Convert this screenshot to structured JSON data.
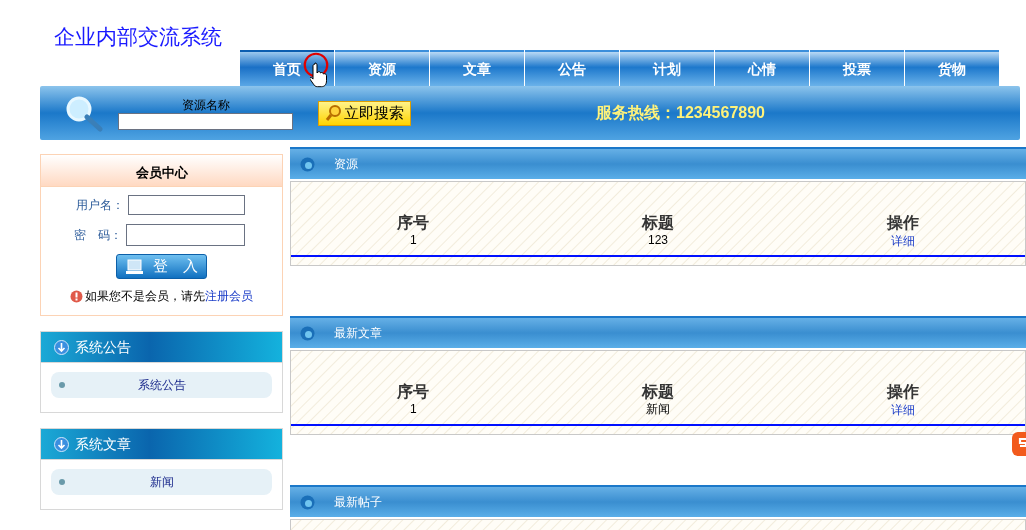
{
  "site_title": "企业内部交流系统",
  "nav_tabs": [
    {
      "label": "首页",
      "selected": true
    },
    {
      "label": "资源",
      "selected": false
    },
    {
      "label": "文章",
      "selected": false
    },
    {
      "label": "公告",
      "selected": false
    },
    {
      "label": "计划",
      "selected": false
    },
    {
      "label": "心情",
      "selected": false
    },
    {
      "label": "投票",
      "selected": false
    },
    {
      "label": "货物",
      "selected": false
    }
  ],
  "search": {
    "label": "资源名称",
    "button": "立即搜索",
    "hotline": "服务热线：1234567890"
  },
  "member_center": {
    "title": "会员中心",
    "username_label": "用户名：",
    "password_label": "密　码：",
    "login_button": "登　入",
    "notice": "如果您不是会员，请先",
    "register_link": "注册会员"
  },
  "side_panels": [
    {
      "title": "系统公告",
      "items": [
        "系统公告"
      ]
    },
    {
      "title": "系统文章",
      "items": [
        "新闻"
      ]
    }
  ],
  "sections": [
    {
      "title": "资源",
      "columns": [
        "序号",
        "标题",
        "操作"
      ],
      "rows": [
        [
          "1",
          "123",
          "详细"
        ]
      ]
    },
    {
      "title": "最新文章",
      "columns": [
        "序号",
        "标题",
        "操作"
      ],
      "rows": [
        [
          "1",
          "新闻",
          "详细"
        ]
      ]
    },
    {
      "title": "最新帖子"
    }
  ]
}
